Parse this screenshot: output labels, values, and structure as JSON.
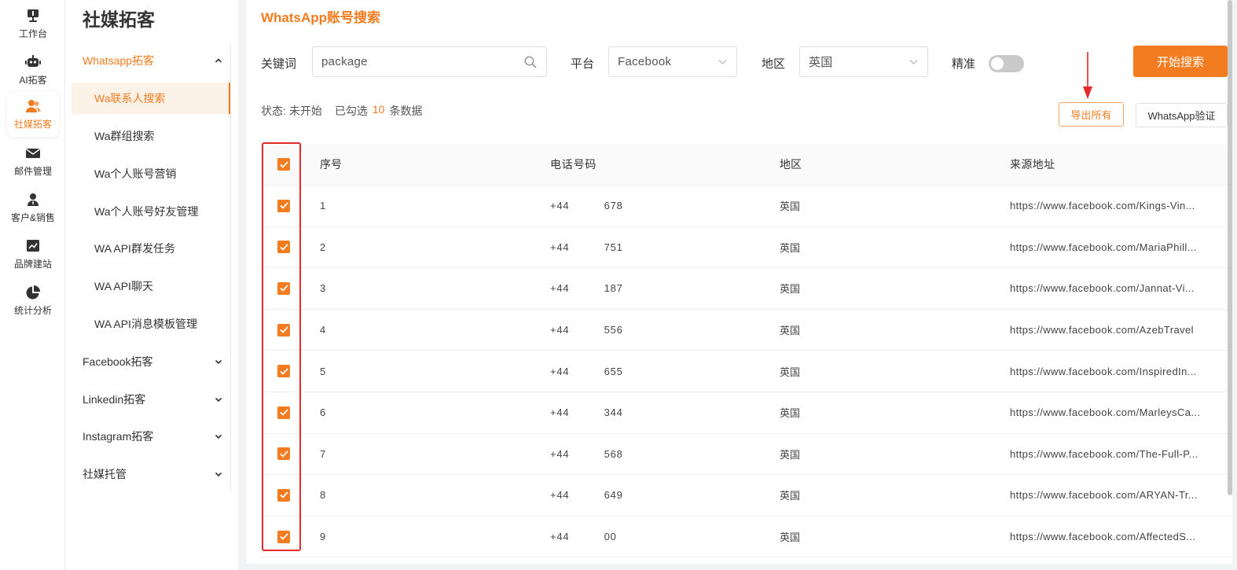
{
  "rail": [
    {
      "label": "工作台",
      "icon": "workbench-icon"
    },
    {
      "label": "AI拓客",
      "icon": "robot-icon"
    },
    {
      "label": "社媒拓客",
      "icon": "users-icon",
      "active": true
    },
    {
      "label": "邮件管理",
      "icon": "mail-icon"
    },
    {
      "label": "客户&销售",
      "icon": "customer-icon"
    },
    {
      "label": "品牌建站",
      "icon": "chart-line-icon"
    },
    {
      "label": "统计分析",
      "icon": "pie-chart-icon"
    }
  ],
  "menu": {
    "title": "社媒拓客",
    "groups": [
      {
        "label": "Whatsapp拓客",
        "open": true
      },
      {
        "label": "Facebook拓客"
      },
      {
        "label": "Linkedin拓客"
      },
      {
        "label": "Instagram拓客"
      },
      {
        "label": "社媒托管"
      }
    ],
    "sub_items": [
      {
        "label": "Wa联系人搜索",
        "active": true
      },
      {
        "label": "Wa群组搜索"
      },
      {
        "label": "Wa个人账号营销"
      },
      {
        "label": "Wa个人账号好友管理"
      },
      {
        "label": "WA API群发任务"
      },
      {
        "label": "WA API聊天"
      },
      {
        "label": "WA API消息模板管理"
      }
    ]
  },
  "page": {
    "title": "WhatsApp账号搜索"
  },
  "search": {
    "keyword_label": "关键词",
    "keyword_value": "package",
    "platform_label": "平台",
    "platform_value": "Facebook",
    "region_label": "地区",
    "region_value": "英国",
    "precise_label": "精准",
    "precise_on": false,
    "start_button": "开始搜索"
  },
  "status": {
    "label": "状态:",
    "value": "未开始",
    "selected_prefix": "已勾选",
    "selected_count": "10",
    "selected_suffix": "条数据"
  },
  "actions": {
    "export_all": "导出所有",
    "whatsapp_verify": "WhatsApp验证"
  },
  "table": {
    "headers": [
      "序号",
      "电话号码",
      "地区",
      "来源地址"
    ],
    "rows": [
      {
        "seq": "1",
        "phone": "+44          678",
        "region": "英国",
        "url": "https://www.facebook.com/Kings-Vin..."
      },
      {
        "seq": "2",
        "phone": "+44          751",
        "region": "英国",
        "url": "https://www.facebook.com/MariaPhill..."
      },
      {
        "seq": "3",
        "phone": "+44          187",
        "region": "英国",
        "url": "https://www.facebook.com/Jannat-Vi..."
      },
      {
        "seq": "4",
        "phone": "+44          556",
        "region": "英国",
        "url": "https://www.facebook.com/AzebTravel"
      },
      {
        "seq": "5",
        "phone": "+44          655",
        "region": "英国",
        "url": "https://www.facebook.com/InspiredIn..."
      },
      {
        "seq": "6",
        "phone": "+44          344",
        "region": "英国",
        "url": "https://www.facebook.com/MarleysCa..."
      },
      {
        "seq": "7",
        "phone": "+44          568",
        "region": "英国",
        "url": "https://www.facebook.com/The-Full-P..."
      },
      {
        "seq": "8",
        "phone": "+44          649",
        "region": "英国",
        "url": "https://www.facebook.com/ARYAN-Tr..."
      },
      {
        "seq": "9",
        "phone": "+44          00",
        "region": "英国",
        "url": "https://www.facebook.com/AffectedS..."
      }
    ]
  },
  "colors": {
    "accent": "#f47c20",
    "highlight_box": "#e42a2a"
  }
}
